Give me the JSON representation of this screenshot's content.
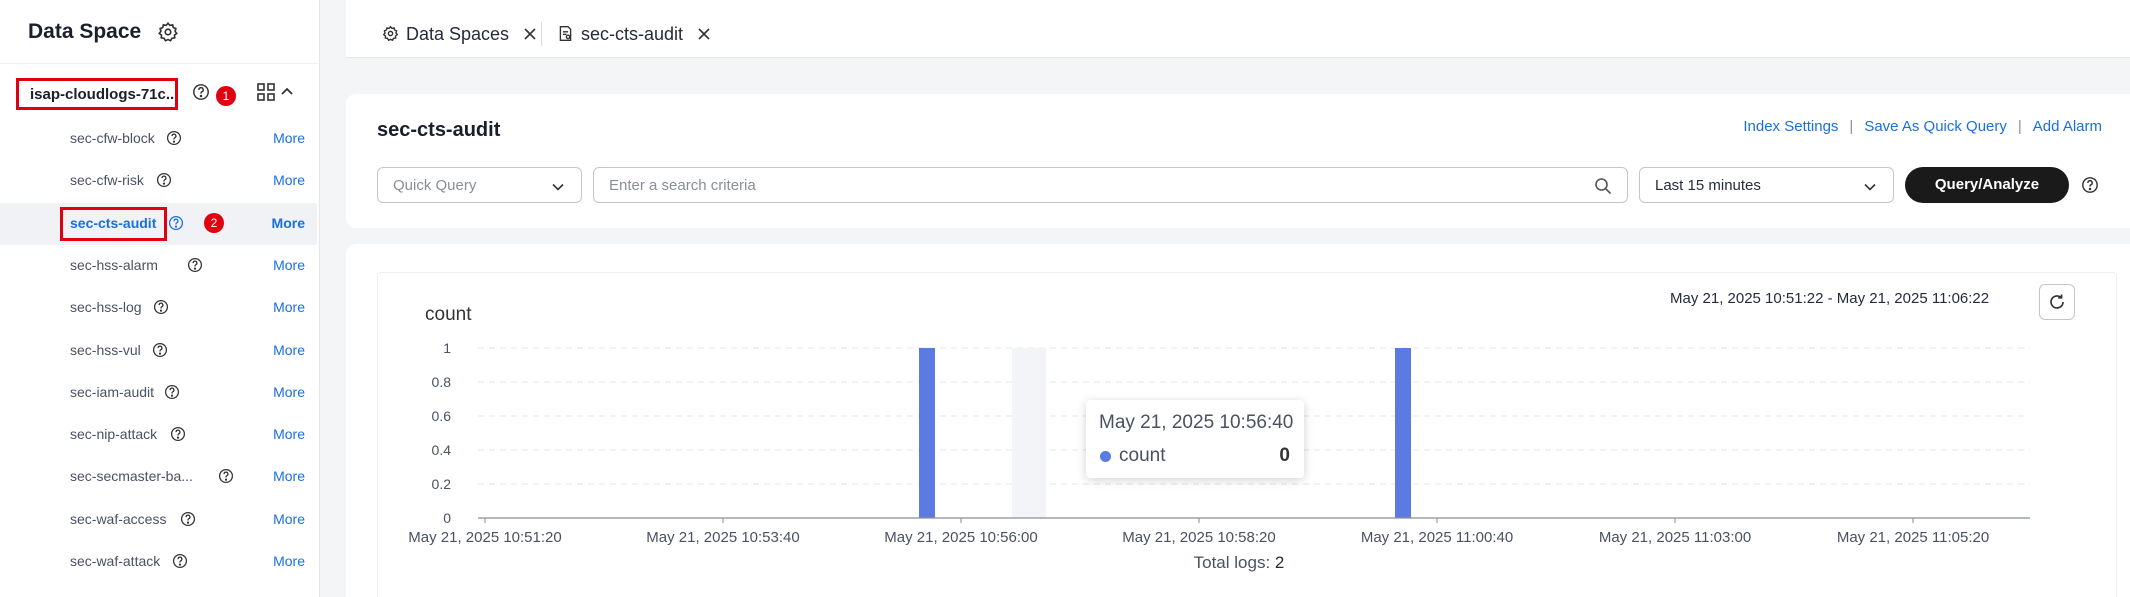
{
  "sidebar": {
    "title": "Data Space",
    "group": {
      "name": "isap-cloudlogs-71c...",
      "badge": "1"
    },
    "items": [
      {
        "label": "sec-cfw-block",
        "more": "More"
      },
      {
        "label": "sec-cfw-risk",
        "more": "More"
      },
      {
        "label": "sec-cts-audit",
        "more": "More",
        "badge": "2",
        "active": true
      },
      {
        "label": "sec-hss-alarm",
        "more": "More"
      },
      {
        "label": "sec-hss-log",
        "more": "More"
      },
      {
        "label": "sec-hss-vul",
        "more": "More"
      },
      {
        "label": "sec-iam-audit",
        "more": "More"
      },
      {
        "label": "sec-nip-attack",
        "more": "More"
      },
      {
        "label": "sec-secmaster-ba...",
        "more": "More"
      },
      {
        "label": "sec-waf-access",
        "more": "More"
      },
      {
        "label": "sec-waf-attack",
        "more": "More"
      }
    ]
  },
  "tabs": [
    {
      "label": "Data Spaces",
      "icon": "gear-icon"
    },
    {
      "label": "sec-cts-audit",
      "icon": "log-stream-icon"
    }
  ],
  "header": {
    "title": "sec-cts-audit",
    "links": [
      "Index Settings",
      "Save As Quick Query",
      "Add Alarm"
    ]
  },
  "search": {
    "quick_query_placeholder": "Quick Query",
    "placeholder": "Enter a search criteria",
    "time_range": "Last 15 minutes",
    "button": "Query/Analyze"
  },
  "chart": {
    "range_text": "May 21, 2025 10:51:22 - May 21, 2025 11:06:22",
    "total_label": "Total logs:",
    "total_value": "2",
    "tooltip": {
      "time": "May 21, 2025 10:56:40",
      "series": "count",
      "value": "0"
    }
  },
  "colors": {
    "accent": "#1a6fe0",
    "bar": "#5b7be3",
    "highlight": "#e0000f"
  },
  "chart_data": {
    "type": "bar",
    "ylabel": "count",
    "ylim": [
      0,
      1
    ],
    "yticks": [
      "0",
      "0.2",
      "0.4",
      "0.6",
      "0.8",
      "1"
    ],
    "xticks": [
      "May 21, 2025 10:51:20",
      "May 21, 2025 10:53:40",
      "May 21, 2025 10:56:00",
      "May 21, 2025 10:58:20",
      "May 21, 2025 11:00:40",
      "May 21, 2025 11:03:00",
      "May 21, 2025 11:05:20"
    ],
    "series": [
      {
        "name": "count",
        "points": [
          {
            "x": "May 21, 2025 10:55:40",
            "y": 1
          },
          {
            "x": "May 21, 2025 11:00:20",
            "y": 1
          }
        ]
      }
    ]
  }
}
